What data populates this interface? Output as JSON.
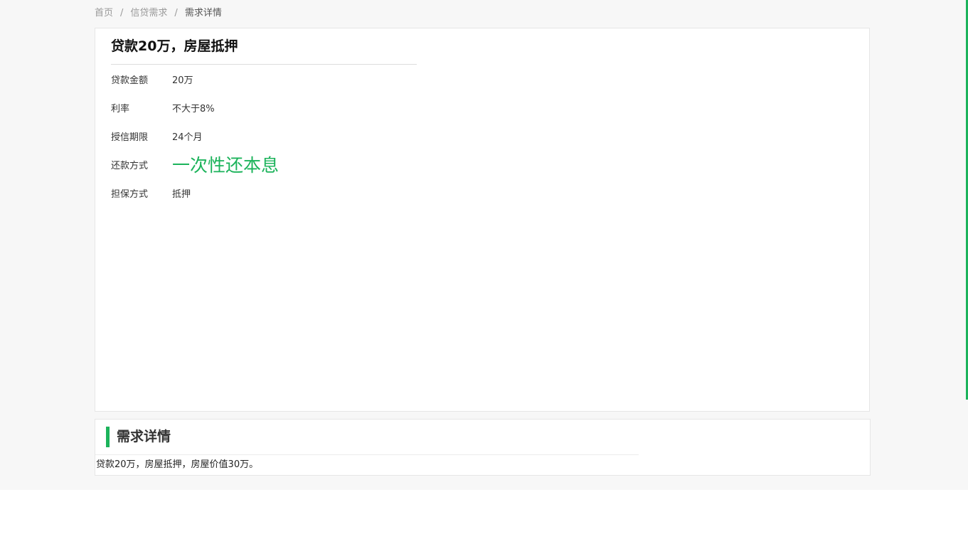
{
  "breadcrumb": {
    "items": [
      "首页",
      "信贷需求"
    ],
    "separator": "/",
    "current": "需求详情"
  },
  "loan": {
    "title": "贷款20万，房屋抵押",
    "rows": [
      {
        "label": "贷款金额",
        "value": "20万"
      },
      {
        "label": "利率",
        "value": "不大于8%"
      },
      {
        "label": "授信期限",
        "value": "24个月"
      },
      {
        "label": "还款方式",
        "value": "一次性还本息"
      },
      {
        "label": "担保方式",
        "value": "抵押"
      }
    ]
  },
  "detail": {
    "title": "需求详情",
    "text": "贷款20万，房屋抵押，房屋价值30万。"
  },
  "colors": {
    "accent": "#1cb35b",
    "page_background": "#f7f7f7"
  }
}
